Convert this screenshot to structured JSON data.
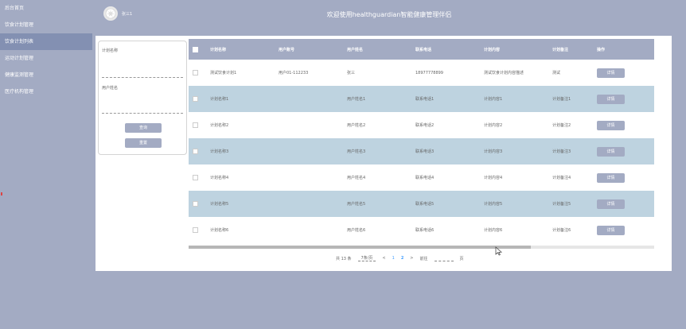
{
  "sidebar": {
    "items": [
      {
        "label": "后台首页"
      },
      {
        "label": "饮食计划管理"
      },
      {
        "label": "饮食计划列表",
        "active": true
      },
      {
        "label": "运动计划管理"
      },
      {
        "label": "健康监测管理"
      },
      {
        "label": "医疗机构管理"
      }
    ]
  },
  "header": {
    "username": "张三1",
    "welcome": "欢迎使用healthguardian智能健康管理伴侣"
  },
  "search": {
    "plan_name_label": "计划名称",
    "plan_name_value": "",
    "user_name_label": "用户姓名",
    "user_name_value": "",
    "query_label": "查询",
    "reset_label": "重置"
  },
  "table": {
    "columns": [
      "计划名称",
      "用户账号",
      "用户姓名",
      "联系电话",
      "计划内容",
      "计划备注",
      "操作"
    ],
    "detail_label": "详情",
    "rows": [
      {
        "name": "测试饮食计划1",
        "account": "用户01-112233",
        "user": "张三",
        "phone": "18977778899",
        "content": "测试饮食计划内容描述",
        "note": "测试"
      },
      {
        "name": "计划名称1",
        "account": "",
        "user": "用户姓名1",
        "phone": "联系电话1",
        "content": "计划内容1",
        "note": "计划备注1"
      },
      {
        "name": "计划名称2",
        "account": "",
        "user": "用户姓名2",
        "phone": "联系电话2",
        "content": "计划内容2",
        "note": "计划备注2"
      },
      {
        "name": "计划名称3",
        "account": "",
        "user": "用户姓名3",
        "phone": "联系电话3",
        "content": "计划内容3",
        "note": "计划备注3"
      },
      {
        "name": "计划名称4",
        "account": "",
        "user": "用户姓名4",
        "phone": "联系电话4",
        "content": "计划内容4",
        "note": "计划备注4"
      },
      {
        "name": "计划名称5",
        "account": "",
        "user": "用户姓名5",
        "phone": "联系电话5",
        "content": "计划内容5",
        "note": "计划备注5"
      },
      {
        "name": "计划名称6",
        "account": "",
        "user": "用户姓名6",
        "phone": "联系电话6",
        "content": "计划内容6",
        "note": "计划备注6"
      }
    ]
  },
  "pagination": {
    "total": "共 13 条",
    "page_size": "7条/页",
    "prev": "<",
    "pages": [
      "1",
      "2"
    ],
    "current": "2",
    "next": ">",
    "goto_label": "前往",
    "page_suffix": "页"
  },
  "colors": {
    "sidebar_bg": "#a3abc3",
    "active_item": "#8390b2",
    "alt_row": "#bed3e0",
    "link": "#409eff"
  }
}
